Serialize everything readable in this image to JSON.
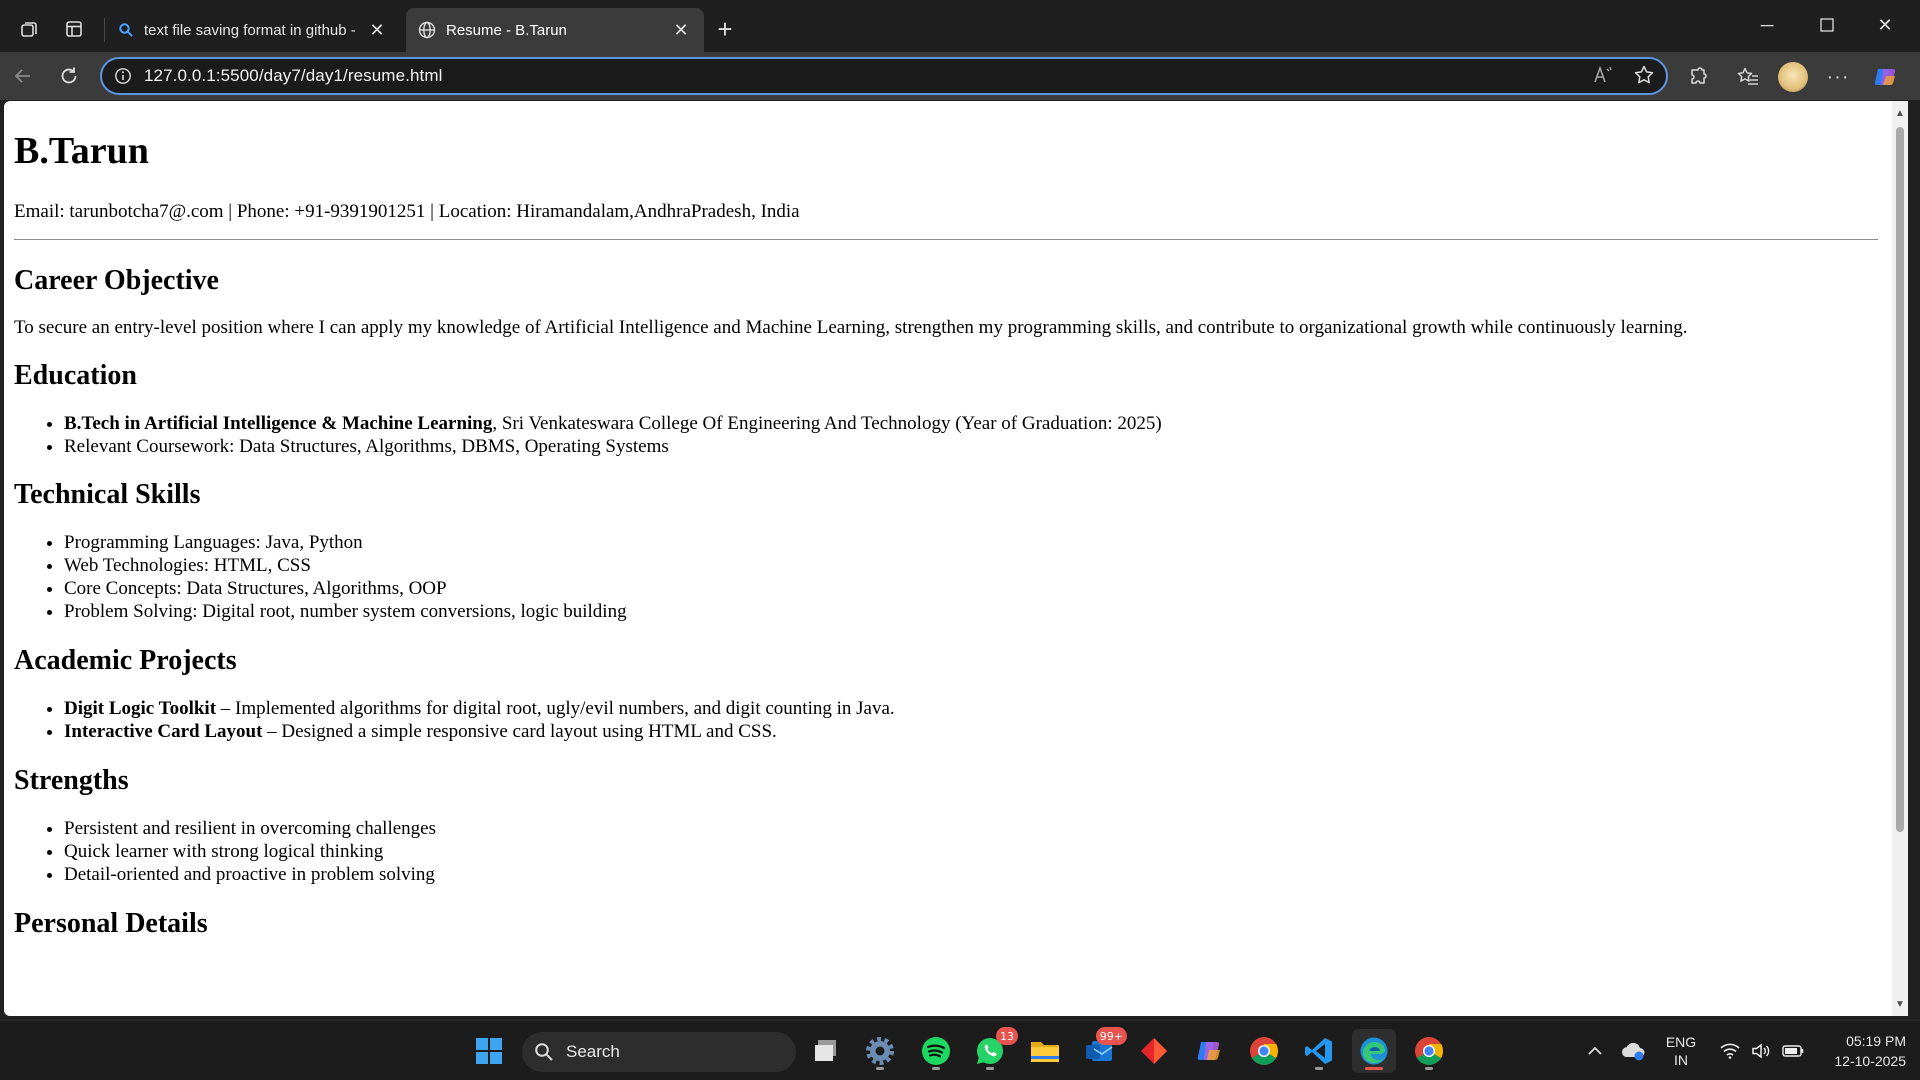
{
  "browser": {
    "tabs": [
      {
        "title": "text file saving format in github -",
        "icon": "search-icon"
      },
      {
        "title": "Resume - B.Tarun",
        "icon": "globe-icon"
      }
    ],
    "url": "127.0.0.1:5500/day7/day1/resume.html",
    "accent_color": "#5b95e0"
  },
  "resume": {
    "name": "B.Tarun",
    "contact": "Email: tarunbotcha7@.com | Phone: +91-9391901251 | Location: Hiramandalam,AndhraPradesh, India",
    "objective": {
      "heading": "Career Objective",
      "text": "To secure an entry-level position where I can apply my knowledge of Artificial Intelligence and Machine Learning, strengthen my programming skills, and contribute to organizational growth while continuously learning."
    },
    "education": {
      "heading": "Education",
      "degree_bold": "B.Tech in Artificial Intelligence & Machine Learning",
      "degree_rest": ", Sri Venkateswara College Of Engineering And Technology (Year of Graduation: 2025)",
      "coursework": "Relevant Coursework: Data Structures, Algorithms, DBMS, Operating Systems"
    },
    "skills": {
      "heading": "Technical Skills",
      "items": [
        "Programming Languages: Java, Python",
        "Web Technologies: HTML, CSS",
        "Core Concepts: Data Structures, Algorithms, OOP",
        "Problem Solving: Digital root, number system conversions, logic building"
      ]
    },
    "projects": {
      "heading": "Academic Projects",
      "items": [
        {
          "title": "Digit Logic Toolkit",
          "desc": " – Implemented algorithms for digital root, ugly/evil numbers, and digit counting in Java."
        },
        {
          "title": "Interactive Card Layout",
          "desc": " – Designed a simple responsive card layout using HTML and CSS."
        }
      ]
    },
    "strengths": {
      "heading": "Strengths",
      "items": [
        "Persistent and resilient in overcoming challenges",
        "Quick learner with strong logical thinking",
        "Detail-oriented and proactive in problem solving"
      ]
    },
    "personal": {
      "heading": "Personal Details"
    }
  },
  "taskbar": {
    "search_label": "Search",
    "whatsapp_badge": "13",
    "outlook_badge": "99+",
    "language_top": "ENG",
    "language_bottom": "IN",
    "time": "05:19 PM",
    "date": "12-10-2025"
  }
}
